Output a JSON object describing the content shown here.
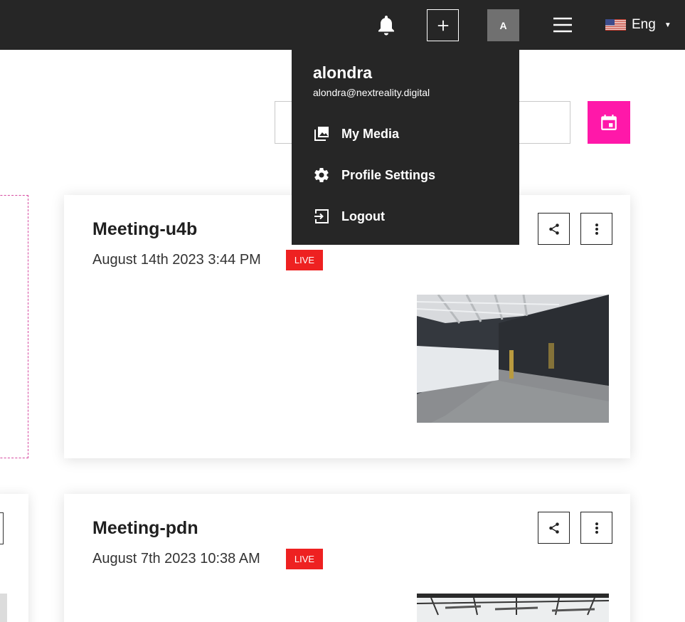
{
  "header": {
    "avatar_initial": "A",
    "language_label": "Eng",
    "icons": [
      "bell-icon",
      "plus-icon",
      "hamburger-icon",
      "us-flag-icon",
      "caret-down-icon"
    ]
  },
  "profile_menu": {
    "username": "alondra",
    "email": "alondra@nextreality.digital",
    "items": [
      {
        "label": "My Media",
        "icon": "media-icon"
      },
      {
        "label": "Profile Settings",
        "icon": "gear-icon"
      },
      {
        "label": "Logout",
        "icon": "logout-icon"
      }
    ]
  },
  "search": {
    "value": "",
    "placeholder": ""
  },
  "colors": {
    "topbar": "#262626",
    "accent_pink": "#ff18a9",
    "live_red": "#ee2121"
  },
  "meetings": [
    {
      "title": "Meeting-u4b",
      "date": "August 14th 2023 3:44 PM",
      "status": "LIVE"
    },
    {
      "title": "Meeting-pdn",
      "date": "August 7th 2023 10:38 AM",
      "status": "LIVE"
    }
  ]
}
